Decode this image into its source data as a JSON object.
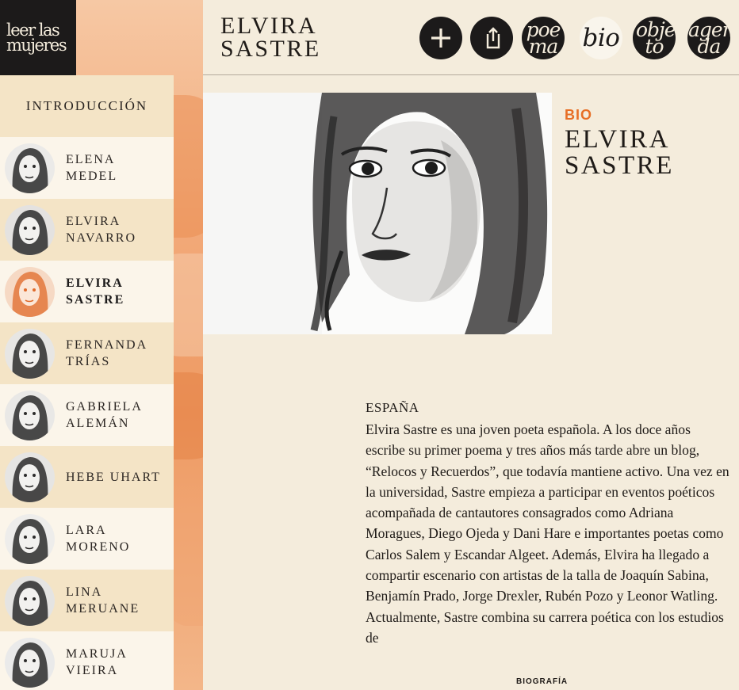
{
  "logo": {
    "line1": "leer las",
    "line2": "mujeres"
  },
  "header": {
    "title": "ELVIRA SASTRE",
    "buttons": [
      {
        "name": "add-button",
        "icon": "plus-icon"
      },
      {
        "name": "share-button",
        "icon": "share-icon"
      },
      {
        "name": "poema-button",
        "label": "poe ma"
      },
      {
        "name": "bio-button",
        "label": "bio",
        "active": true
      },
      {
        "name": "objeto-button",
        "label": "obje to"
      },
      {
        "name": "agenda-button",
        "label": "agen da"
      }
    ]
  },
  "sidebar": {
    "intro": "INTRODUCCIÓN",
    "items": [
      {
        "name": "ELENA MEDEL"
      },
      {
        "name": "ELVIRA NAVARRO"
      },
      {
        "name": "ELVIRA SASTRE",
        "current": true
      },
      {
        "name": "FERNANDA TRÍAS"
      },
      {
        "name": "GABRIELA ALEMÁN"
      },
      {
        "name": "HEBE UHART"
      },
      {
        "name": "LARA MORENO"
      },
      {
        "name": "LINA MERUANE"
      },
      {
        "name": "MARUJA VIEIRA"
      }
    ]
  },
  "bio": {
    "tag": "BIO",
    "name": "ELVIRA SASTRE",
    "country": "ESPAÑA",
    "text": "Elvira Sastre es una joven poeta española. A los doce años escribe su primer poema y tres años más tarde abre un blog, “Relocos y Recuerdos”, que todavía mantiene activo. Una vez en la universidad, Sastre empieza a participar en eventos poéticos acompañada de cantautores consagrados como Adriana Moragues, Diego Ojeda y Dani Hare e importantes poetas como Carlos Salem y Escandar Algeet. Además, Elvira ha llegado a compartir escenario con artistas de la talla de Joaquín Sabina, Benjamín Prado, Jorge Drexler, Rubén Pozo y Leonor Watling. Actualmente, Sastre combina su carrera poética con los estudios de"
  },
  "footer": {
    "label": "BIOGRAFÍA"
  },
  "colors": {
    "accent": "#e76f26",
    "paper": "#f4ecdc",
    "ink": "#1c1a1a"
  }
}
